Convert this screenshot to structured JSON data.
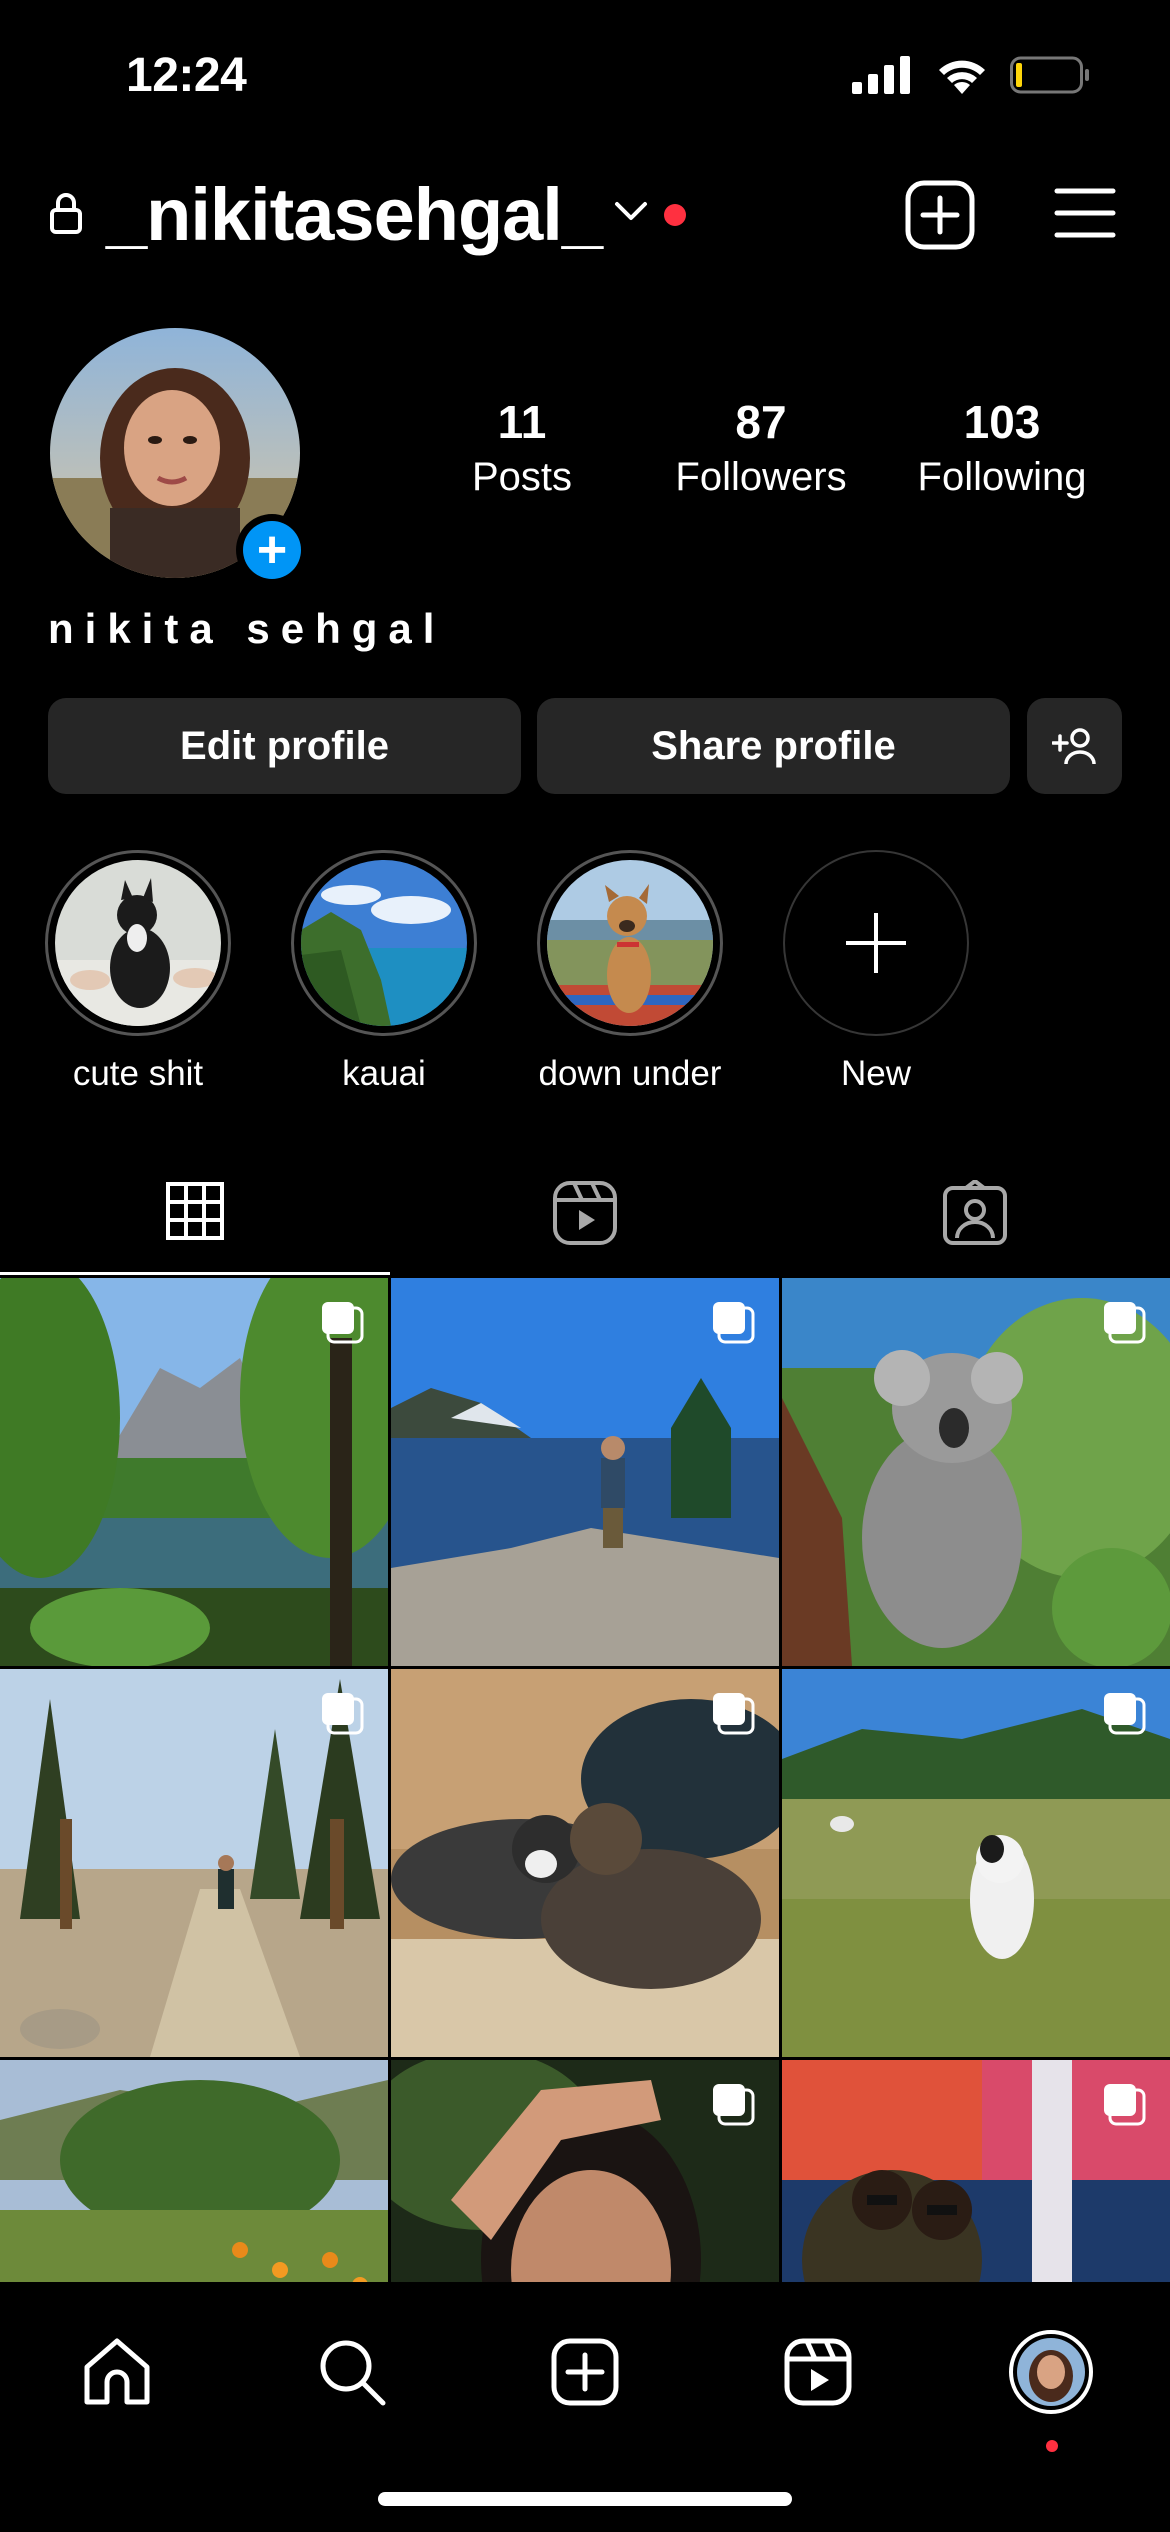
{
  "status_bar": {
    "time": "12:24"
  },
  "header": {
    "username": "_nikitasehgal_"
  },
  "profile": {
    "display_name": "nikita sehgal",
    "stats": [
      {
        "value": "11",
        "label": "Posts"
      },
      {
        "value": "87",
        "label": "Followers"
      },
      {
        "value": "103",
        "label": "Following"
      }
    ]
  },
  "actions": {
    "edit_label": "Edit profile",
    "share_label": "Share profile"
  },
  "highlights": [
    {
      "label": "cute shit"
    },
    {
      "label": "kauai"
    },
    {
      "label": "down under"
    },
    {
      "label": "New"
    }
  ],
  "tabs": [
    "grid-icon",
    "reels-icon",
    "tagged-icon"
  ],
  "posts_count_visible": 9,
  "colors": {
    "accent_blue": "#0095f6",
    "notification_red": "#ff3040",
    "button_bg": "#262626"
  }
}
